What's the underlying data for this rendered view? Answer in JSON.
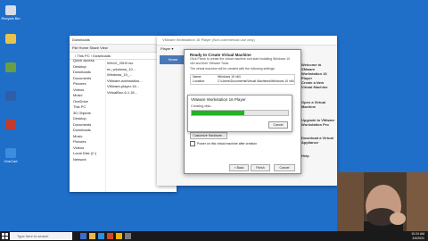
{
  "desktop": {
    "icons": [
      {
        "label": "Recycle Bin",
        "color": "#d8dde6"
      },
      {
        "label": "",
        "color": "#e8c24a"
      },
      {
        "label": "",
        "color": "#6a9e43"
      },
      {
        "label": "",
        "color": "#2f5ea8"
      },
      {
        "label": "",
        "color": "#c43a2e"
      },
      {
        "label": "OneCad",
        "color": "#3c8dde"
      }
    ]
  },
  "explorer": {
    "title": "Downloads",
    "ribbon": "File  Home  Share  View",
    "address": "› This PC › Downloads",
    "nav": [
      "Quick access",
      "Desktop",
      "Downloads",
      "Documents",
      "Pictures",
      "Videos",
      "Music",
      "OneDrive",
      "This PC",
      "3D Objects",
      "Desktop",
      "Documents",
      "Downloads",
      "Music",
      "Pictures",
      "Videos",
      "Local Disk (C:)",
      "Network"
    ],
    "files": [
      "Win10_20H2.iso",
      "en_windows_10...",
      "Windows_10_...",
      "VMware-workstation...",
      "VMware-player-16...",
      "VirtualBox-6.1.18..."
    ]
  },
  "vmware": {
    "title": "VMware Workstation 16 Player (Non-commercial use only)",
    "toolbar": "Player ▾",
    "home_tab": "Home",
    "headings": [
      "Welcome to VMware Workstation 16 Player",
      "Create a New Virtual Machine",
      "Open a Virtual Machine",
      "Upgrade to VMware Workstation Pro",
      "Download a Virtual Appliance",
      "Help"
    ]
  },
  "wizard": {
    "title": "Ready to Create Virtual Machine",
    "text": "Click Finish to create the virtual machine and start installing Windows 10 x64 and then VMware Tools.",
    "subtext": "The virtual machine will be created with the following settings:",
    "rows": [
      {
        "k": "Name:",
        "v": "Windows 10 x64"
      },
      {
        "k": "Location:",
        "v": "C:\\Users\\Documents\\Virtual Machines\\Windows 10 x64"
      }
    ],
    "customize": "Customize Hardware...",
    "checkbox": "Power on this virtual machine after creation",
    "back": "< Back",
    "finish": "Finish",
    "cancel": "Cancel"
  },
  "progress": {
    "title": "VMware Workstation 16 Player",
    "status": "Creating disk...",
    "value": 0.55,
    "cancel": "Cancel"
  },
  "taskbar": {
    "search": "Type here to search",
    "time": "10:24 AM",
    "date": "2/4/2021"
  }
}
